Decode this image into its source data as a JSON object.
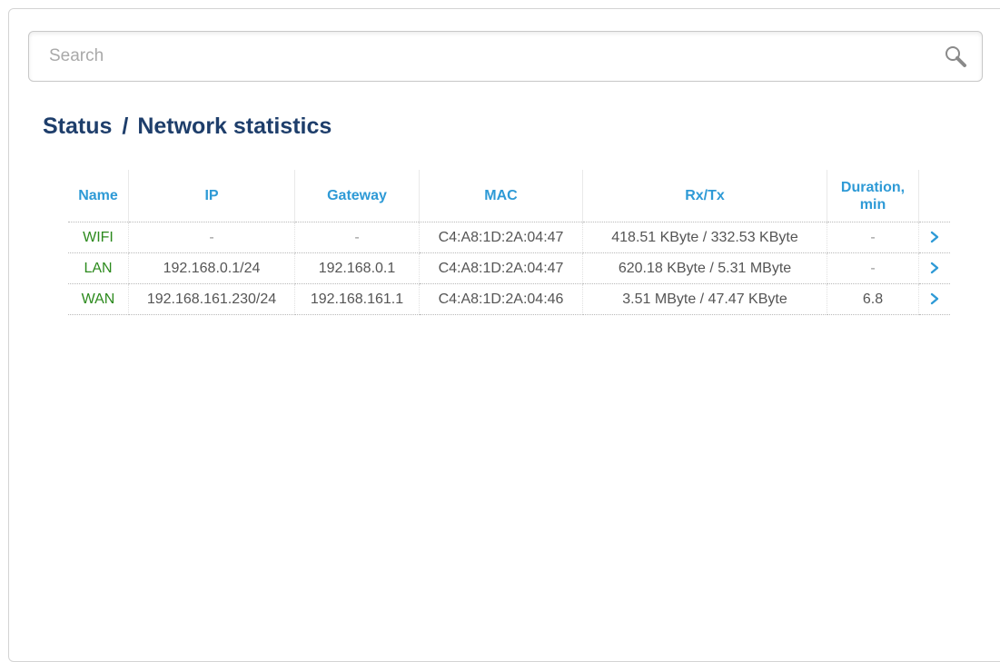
{
  "search": {
    "placeholder": "Search",
    "value": ""
  },
  "breadcrumb": {
    "section": "Status",
    "separator": "/",
    "page": "Network statistics"
  },
  "table": {
    "headers": {
      "name": "Name",
      "ip": "IP",
      "gateway": "Gateway",
      "mac": "MAC",
      "rxtx": "Rx/Tx",
      "duration_line1": "Duration,",
      "duration_line2": "min"
    },
    "rows": [
      {
        "name": "WIFI",
        "ip": "-",
        "gateway": "-",
        "mac": "C4:A8:1D:2A:04:47",
        "rxtx": "418.51 KByte / 332.53 KByte",
        "duration": "-"
      },
      {
        "name": "LAN",
        "ip": "192.168.0.1/24",
        "gateway": "192.168.0.1",
        "mac": "C4:A8:1D:2A:04:47",
        "rxtx": "620.18 KByte / 5.31 MByte",
        "duration": "-"
      },
      {
        "name": "WAN",
        "ip": "192.168.161.230/24",
        "gateway": "192.168.161.1",
        "mac": "C4:A8:1D:2A:04:46",
        "rxtx": "3.51 MByte / 47.47 KByte",
        "duration": "6.8"
      }
    ]
  },
  "icons": {
    "search": "search-icon",
    "row_arrow": "chevron-right-icon"
  },
  "colors": {
    "title": "#1e3e6b",
    "header": "#2e9ad6",
    "name": "#2c8a1d",
    "chevron": "#2e9ad6"
  }
}
